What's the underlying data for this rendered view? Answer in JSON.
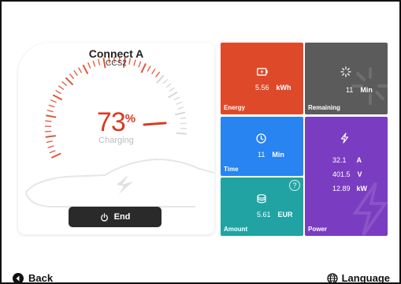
{
  "connector": {
    "name": "Connect A",
    "type": "CCS2"
  },
  "charge": {
    "percent": "73",
    "percent_sign": "%",
    "status": "Charging",
    "level": 0.73
  },
  "end_button": {
    "label": "End",
    "icon": "power-icon"
  },
  "tiles": {
    "energy": {
      "label": "Energy",
      "value": "5.56",
      "unit": "kWh",
      "icon": "battery-charging-icon",
      "color": "#de4a29"
    },
    "remaining": {
      "label": "Remaining",
      "value": "11",
      "unit": "Min",
      "icon": "loading-spinner-icon",
      "color": "#5b5b5b"
    },
    "time": {
      "label": "Time",
      "value": "11",
      "unit": "Min",
      "icon": "clock-icon",
      "color": "#2784f0"
    },
    "amount": {
      "label": "Amount",
      "value": "5.61",
      "unit": "EUR",
      "icon": "coins-icon",
      "help": "?",
      "color": "#21a3a3"
    },
    "power": {
      "label": "Power",
      "icon": "lightning-icon",
      "color": "#7a3cc0",
      "rows": [
        {
          "value": "32.1",
          "unit": "A"
        },
        {
          "value": "401.5",
          "unit": "V"
        },
        {
          "value": "12.89",
          "unit": "kW"
        }
      ]
    }
  },
  "footer": {
    "back_label": "Back",
    "back_icon": "back-arrow-icon",
    "language_label": "Language",
    "language_icon": "globe-icon"
  }
}
